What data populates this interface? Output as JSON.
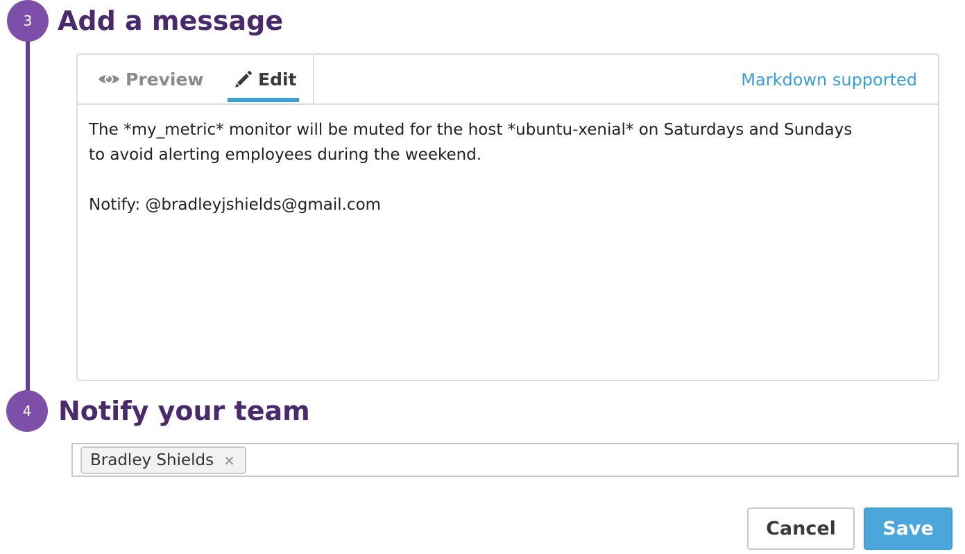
{
  "steps": {
    "message": {
      "number": "3",
      "title": "Add a message"
    },
    "notify": {
      "number": "4",
      "title": "Notify your team"
    }
  },
  "editor": {
    "tabs": {
      "preview": "Preview",
      "edit": "Edit"
    },
    "active_tab": "edit",
    "markdown_label": "Markdown supported",
    "lines": [
      "The *my_metric* monitor will be muted for the host *ubuntu-xenial* on Saturdays and Sundays",
      "to avoid alerting employees during the weekend.",
      "",
      "Notify: @bradleyjshields@gmail.com"
    ]
  },
  "notify": {
    "tags": [
      {
        "label": "Bradley Shields",
        "remove": "×"
      }
    ]
  },
  "actions": {
    "cancel": "Cancel",
    "save": "Save"
  },
  "icons": {
    "preview": "eye-icon",
    "edit": "pencil-icon",
    "remove": "close-icon"
  },
  "colors": {
    "accent_purple": "#7d4fa8",
    "title_purple": "#4a2a6b",
    "link_blue": "#3a9fd6",
    "save_blue": "#4ba6dc"
  }
}
